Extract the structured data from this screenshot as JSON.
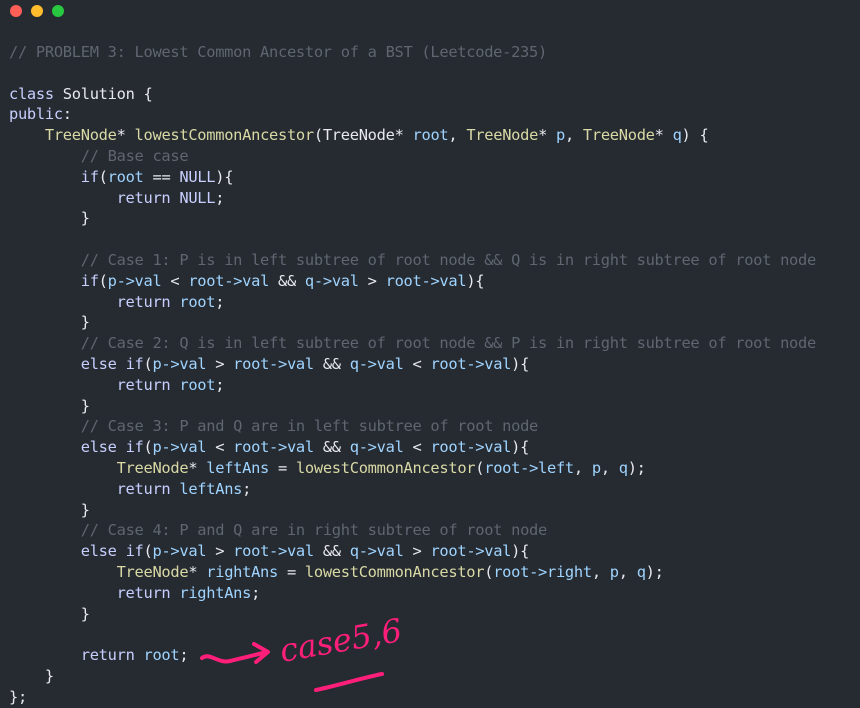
{
  "window": {
    "buttons": {
      "close_color": "#ff5f57",
      "minimize_color": "#ffbd2e",
      "maximize_color": "#28c840"
    }
  },
  "editor": {
    "language": "cpp",
    "lines": [
      {
        "indent": 0,
        "tokens": [
          {
            "t": "// PROBLEM 3: Lowest Common Ancestor of a BST (Leetcode-235)",
            "c": "comment"
          }
        ]
      },
      {
        "indent": 0,
        "tokens": []
      },
      {
        "indent": 0,
        "tokens": [
          {
            "t": "class",
            "c": "kw"
          },
          {
            "t": " Solution {",
            "c": "op"
          }
        ]
      },
      {
        "indent": 0,
        "tokens": [
          {
            "t": "public",
            "c": "kw"
          },
          {
            "t": ":",
            "c": "op"
          }
        ]
      },
      {
        "indent": 4,
        "tokens": [
          {
            "t": "TreeNode",
            "c": "type"
          },
          {
            "t": "* ",
            "c": "op"
          },
          {
            "t": "lowestCommonAncestor",
            "c": "type"
          },
          {
            "t": "(TreeNode* ",
            "c": "op"
          },
          {
            "t": "root",
            "c": "var"
          },
          {
            "t": ", ",
            "c": "op"
          },
          {
            "t": "TreeNode",
            "c": "type"
          },
          {
            "t": "* ",
            "c": "op"
          },
          {
            "t": "p",
            "c": "var"
          },
          {
            "t": ", ",
            "c": "op"
          },
          {
            "t": "TreeNode",
            "c": "type"
          },
          {
            "t": "* ",
            "c": "op"
          },
          {
            "t": "q",
            "c": "var"
          },
          {
            "t": ") {",
            "c": "op"
          }
        ]
      },
      {
        "indent": 8,
        "tokens": [
          {
            "t": "// Base case",
            "c": "comment"
          }
        ]
      },
      {
        "indent": 8,
        "tokens": [
          {
            "t": "if",
            "c": "kw"
          },
          {
            "t": "(",
            "c": "op"
          },
          {
            "t": "root",
            "c": "var"
          },
          {
            "t": " == ",
            "c": "op"
          },
          {
            "t": "NULL",
            "c": "kw"
          },
          {
            "t": "){",
            "c": "op"
          }
        ]
      },
      {
        "indent": 12,
        "tokens": [
          {
            "t": "return",
            "c": "kw"
          },
          {
            "t": " ",
            "c": "op"
          },
          {
            "t": "NULL",
            "c": "kw"
          },
          {
            "t": ";",
            "c": "op"
          }
        ]
      },
      {
        "indent": 8,
        "tokens": [
          {
            "t": "}",
            "c": "op"
          }
        ]
      },
      {
        "indent": 0,
        "tokens": []
      },
      {
        "indent": 8,
        "tokens": [
          {
            "t": "// Case 1: P is in left subtree of root node && Q is in right subtree of root node",
            "c": "comment"
          }
        ]
      },
      {
        "indent": 8,
        "tokens": [
          {
            "t": "if",
            "c": "kw"
          },
          {
            "t": "(",
            "c": "op"
          },
          {
            "t": "p->val",
            "c": "var"
          },
          {
            "t": " < ",
            "c": "op"
          },
          {
            "t": "root->val",
            "c": "var"
          },
          {
            "t": " && ",
            "c": "op"
          },
          {
            "t": "q->val",
            "c": "var"
          },
          {
            "t": " > ",
            "c": "op"
          },
          {
            "t": "root->val",
            "c": "var"
          },
          {
            "t": "){",
            "c": "op"
          }
        ]
      },
      {
        "indent": 12,
        "tokens": [
          {
            "t": "return",
            "c": "kw"
          },
          {
            "t": " ",
            "c": "op"
          },
          {
            "t": "root",
            "c": "var"
          },
          {
            "t": ";",
            "c": "op"
          }
        ]
      },
      {
        "indent": 8,
        "tokens": [
          {
            "t": "}",
            "c": "op"
          }
        ]
      },
      {
        "indent": 8,
        "tokens": [
          {
            "t": "// Case 2: Q is in left subtree of root node && P is in right subtree of root node",
            "c": "comment"
          }
        ]
      },
      {
        "indent": 8,
        "tokens": [
          {
            "t": "else if",
            "c": "kw"
          },
          {
            "t": "(",
            "c": "op"
          },
          {
            "t": "p->val",
            "c": "var"
          },
          {
            "t": " > ",
            "c": "op"
          },
          {
            "t": "root->val",
            "c": "var"
          },
          {
            "t": " && ",
            "c": "op"
          },
          {
            "t": "q->val",
            "c": "var"
          },
          {
            "t": " < ",
            "c": "op"
          },
          {
            "t": "root->val",
            "c": "var"
          },
          {
            "t": "){",
            "c": "op"
          }
        ]
      },
      {
        "indent": 12,
        "tokens": [
          {
            "t": "return",
            "c": "kw"
          },
          {
            "t": " ",
            "c": "op"
          },
          {
            "t": "root",
            "c": "var"
          },
          {
            "t": ";",
            "c": "op"
          }
        ]
      },
      {
        "indent": 8,
        "tokens": [
          {
            "t": "}",
            "c": "op"
          }
        ]
      },
      {
        "indent": 8,
        "tokens": [
          {
            "t": "// Case 3: P and Q are in left subtree of root node",
            "c": "comment"
          }
        ]
      },
      {
        "indent": 8,
        "tokens": [
          {
            "t": "else if",
            "c": "kw"
          },
          {
            "t": "(",
            "c": "op"
          },
          {
            "t": "p->val",
            "c": "var"
          },
          {
            "t": " < ",
            "c": "op"
          },
          {
            "t": "root->val",
            "c": "var"
          },
          {
            "t": " && ",
            "c": "op"
          },
          {
            "t": "q->val",
            "c": "var"
          },
          {
            "t": " < ",
            "c": "op"
          },
          {
            "t": "root->val",
            "c": "var"
          },
          {
            "t": "){",
            "c": "op"
          }
        ]
      },
      {
        "indent": 12,
        "tokens": [
          {
            "t": "TreeNode",
            "c": "type"
          },
          {
            "t": "* ",
            "c": "op"
          },
          {
            "t": "leftAns",
            "c": "var"
          },
          {
            "t": " = ",
            "c": "op"
          },
          {
            "t": "lowestCommonAncestor",
            "c": "type"
          },
          {
            "t": "(",
            "c": "op"
          },
          {
            "t": "root->left",
            "c": "var"
          },
          {
            "t": ", ",
            "c": "op"
          },
          {
            "t": "p",
            "c": "var"
          },
          {
            "t": ", ",
            "c": "op"
          },
          {
            "t": "q",
            "c": "var"
          },
          {
            "t": ");",
            "c": "op"
          }
        ]
      },
      {
        "indent": 12,
        "tokens": [
          {
            "t": "return",
            "c": "kw"
          },
          {
            "t": " ",
            "c": "op"
          },
          {
            "t": "leftAns",
            "c": "var"
          },
          {
            "t": ";",
            "c": "op"
          }
        ]
      },
      {
        "indent": 8,
        "tokens": [
          {
            "t": "}",
            "c": "op"
          }
        ]
      },
      {
        "indent": 8,
        "tokens": [
          {
            "t": "// Case 4: P and Q are in right subtree of root node",
            "c": "comment"
          }
        ]
      },
      {
        "indent": 8,
        "tokens": [
          {
            "t": "else if",
            "c": "kw"
          },
          {
            "t": "(",
            "c": "op"
          },
          {
            "t": "p->val",
            "c": "var"
          },
          {
            "t": " > ",
            "c": "op"
          },
          {
            "t": "root->val",
            "c": "var"
          },
          {
            "t": " && ",
            "c": "op"
          },
          {
            "t": "q->val",
            "c": "var"
          },
          {
            "t": " > ",
            "c": "op"
          },
          {
            "t": "root->val",
            "c": "var"
          },
          {
            "t": "){",
            "c": "op"
          }
        ]
      },
      {
        "indent": 12,
        "tokens": [
          {
            "t": "TreeNode",
            "c": "type"
          },
          {
            "t": "* ",
            "c": "op"
          },
          {
            "t": "rightAns",
            "c": "var"
          },
          {
            "t": " = ",
            "c": "op"
          },
          {
            "t": "lowestCommonAncestor",
            "c": "type"
          },
          {
            "t": "(",
            "c": "op"
          },
          {
            "t": "root->right",
            "c": "var"
          },
          {
            "t": ", ",
            "c": "op"
          },
          {
            "t": "p",
            "c": "var"
          },
          {
            "t": ", ",
            "c": "op"
          },
          {
            "t": "q",
            "c": "var"
          },
          {
            "t": ");",
            "c": "op"
          }
        ]
      },
      {
        "indent": 12,
        "tokens": [
          {
            "t": "return",
            "c": "kw"
          },
          {
            "t": " ",
            "c": "op"
          },
          {
            "t": "rightAns",
            "c": "var"
          },
          {
            "t": ";",
            "c": "op"
          }
        ]
      },
      {
        "indent": 8,
        "tokens": [
          {
            "t": "}",
            "c": "op"
          }
        ]
      },
      {
        "indent": 0,
        "tokens": []
      },
      {
        "indent": 8,
        "tokens": [
          {
            "t": "return",
            "c": "kw"
          },
          {
            "t": " ",
            "c": "op"
          },
          {
            "t": "root",
            "c": "var"
          },
          {
            "t": ";",
            "c": "op"
          }
        ]
      },
      {
        "indent": 4,
        "tokens": [
          {
            "t": "}",
            "c": "op"
          }
        ]
      },
      {
        "indent": 0,
        "tokens": [
          {
            "t": "};",
            "c": "op"
          }
        ]
      }
    ]
  },
  "annotation": {
    "text": "case5,6",
    "color": "#ff1f7a"
  }
}
